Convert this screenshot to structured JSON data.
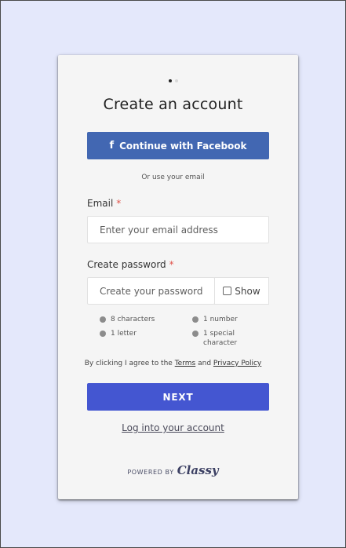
{
  "form": {
    "title": "Create an account",
    "facebook_button": "Continue with Facebook",
    "facebook_icon": "f",
    "or_text": "Or use your email",
    "email_label": "Email",
    "required_mark": "*",
    "email_placeholder": "Enter your email address",
    "password_label": "Create password",
    "password_placeholder": "Create your password",
    "show_label": "Show",
    "requirements": {
      "chars": "8 characters",
      "number": "1 number",
      "letter": "1 letter",
      "special": "1 special character"
    },
    "terms_prefix": "By clicking I agree to the",
    "terms_link": "Terms",
    "terms_and": "and",
    "privacy_link": "Privacy Policy",
    "next_button": "NEXT",
    "login_link": "Log into your account",
    "powered_by": "POWERED BY",
    "brand": "Classy"
  },
  "colors": {
    "facebook": "#4267b2",
    "primary": "#4456d1",
    "required": "#e0524a",
    "background": "#e4e8fb"
  }
}
